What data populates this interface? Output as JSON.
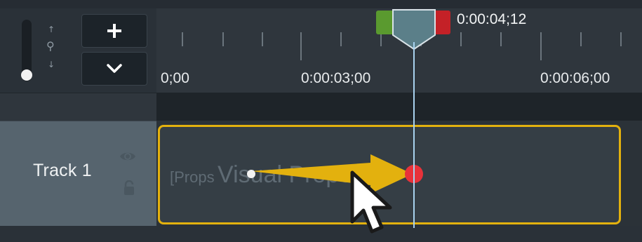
{
  "timeline": {
    "playhead_time": "0:00:04;12",
    "ruler_labels": [
      "0;00",
      "0:00:03;00",
      "0:00:06;00"
    ]
  },
  "toolbar": {
    "add_button_label": "+",
    "collapse_button_icon": "chevron-down-icon",
    "zoom_icons": [
      "arrow-up-icon",
      "magnifier-icon",
      "arrow-down-icon"
    ]
  },
  "track": {
    "label": "Track 1",
    "icons": [
      "eye-icon",
      "lock-icon"
    ]
  },
  "clip": {
    "name_prefix": "[Props",
    "name_rest": "Visual Properties",
    "border_color": "#e3b10e"
  },
  "colors": {
    "in_marker": "#5a9a2f",
    "out_marker": "#c42127",
    "playhead": "#5b7f89",
    "animation_arrow": "#e3b10e",
    "keyframe_end": "#e8323a"
  }
}
